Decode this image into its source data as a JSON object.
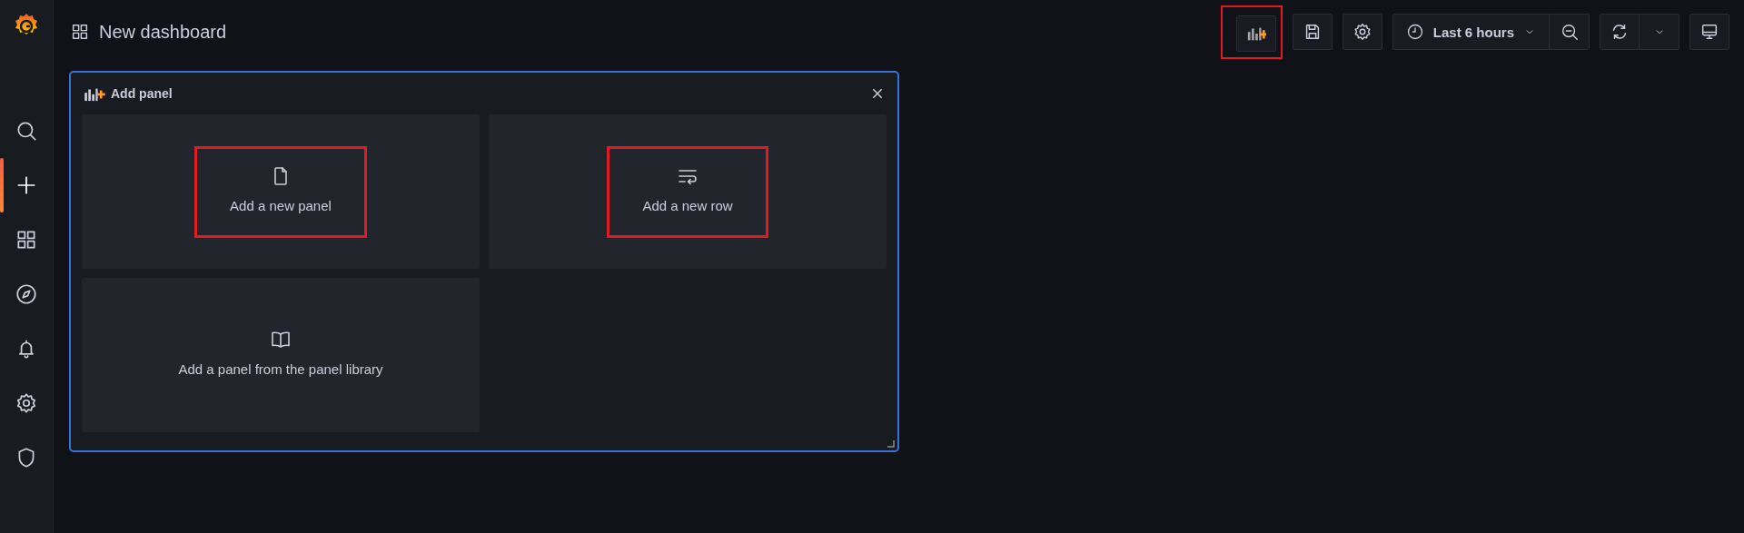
{
  "sidebar": {
    "items": [
      {
        "kind": "search",
        "selected": false
      },
      {
        "kind": "create",
        "selected": true
      },
      {
        "kind": "dashboards",
        "selected": false
      },
      {
        "kind": "explore",
        "selected": false
      },
      {
        "kind": "alerting",
        "selected": false
      },
      {
        "kind": "configuration",
        "selected": false
      },
      {
        "kind": "shield",
        "selected": false
      }
    ]
  },
  "header": {
    "title": "New dashboard"
  },
  "toolbar": {
    "buttons": [
      {
        "kind": "addpanel",
        "highlighted": true
      },
      {
        "kind": "save",
        "highlighted": false
      },
      {
        "kind": "settings",
        "highlighted": false
      }
    ],
    "time_picker": {
      "label": "Last 6 hours"
    },
    "refresh": {
      "kind": "refresh"
    },
    "view": {
      "kind": "tv"
    }
  },
  "add_panel": {
    "title": "Add panel",
    "options": [
      {
        "kind": "file",
        "label": "Add a new panel",
        "highlighted": true
      },
      {
        "kind": "row",
        "label": "Add a new row",
        "highlighted": true
      },
      {
        "kind": "library",
        "label": "Add a panel from the panel library",
        "highlighted": false
      }
    ]
  }
}
